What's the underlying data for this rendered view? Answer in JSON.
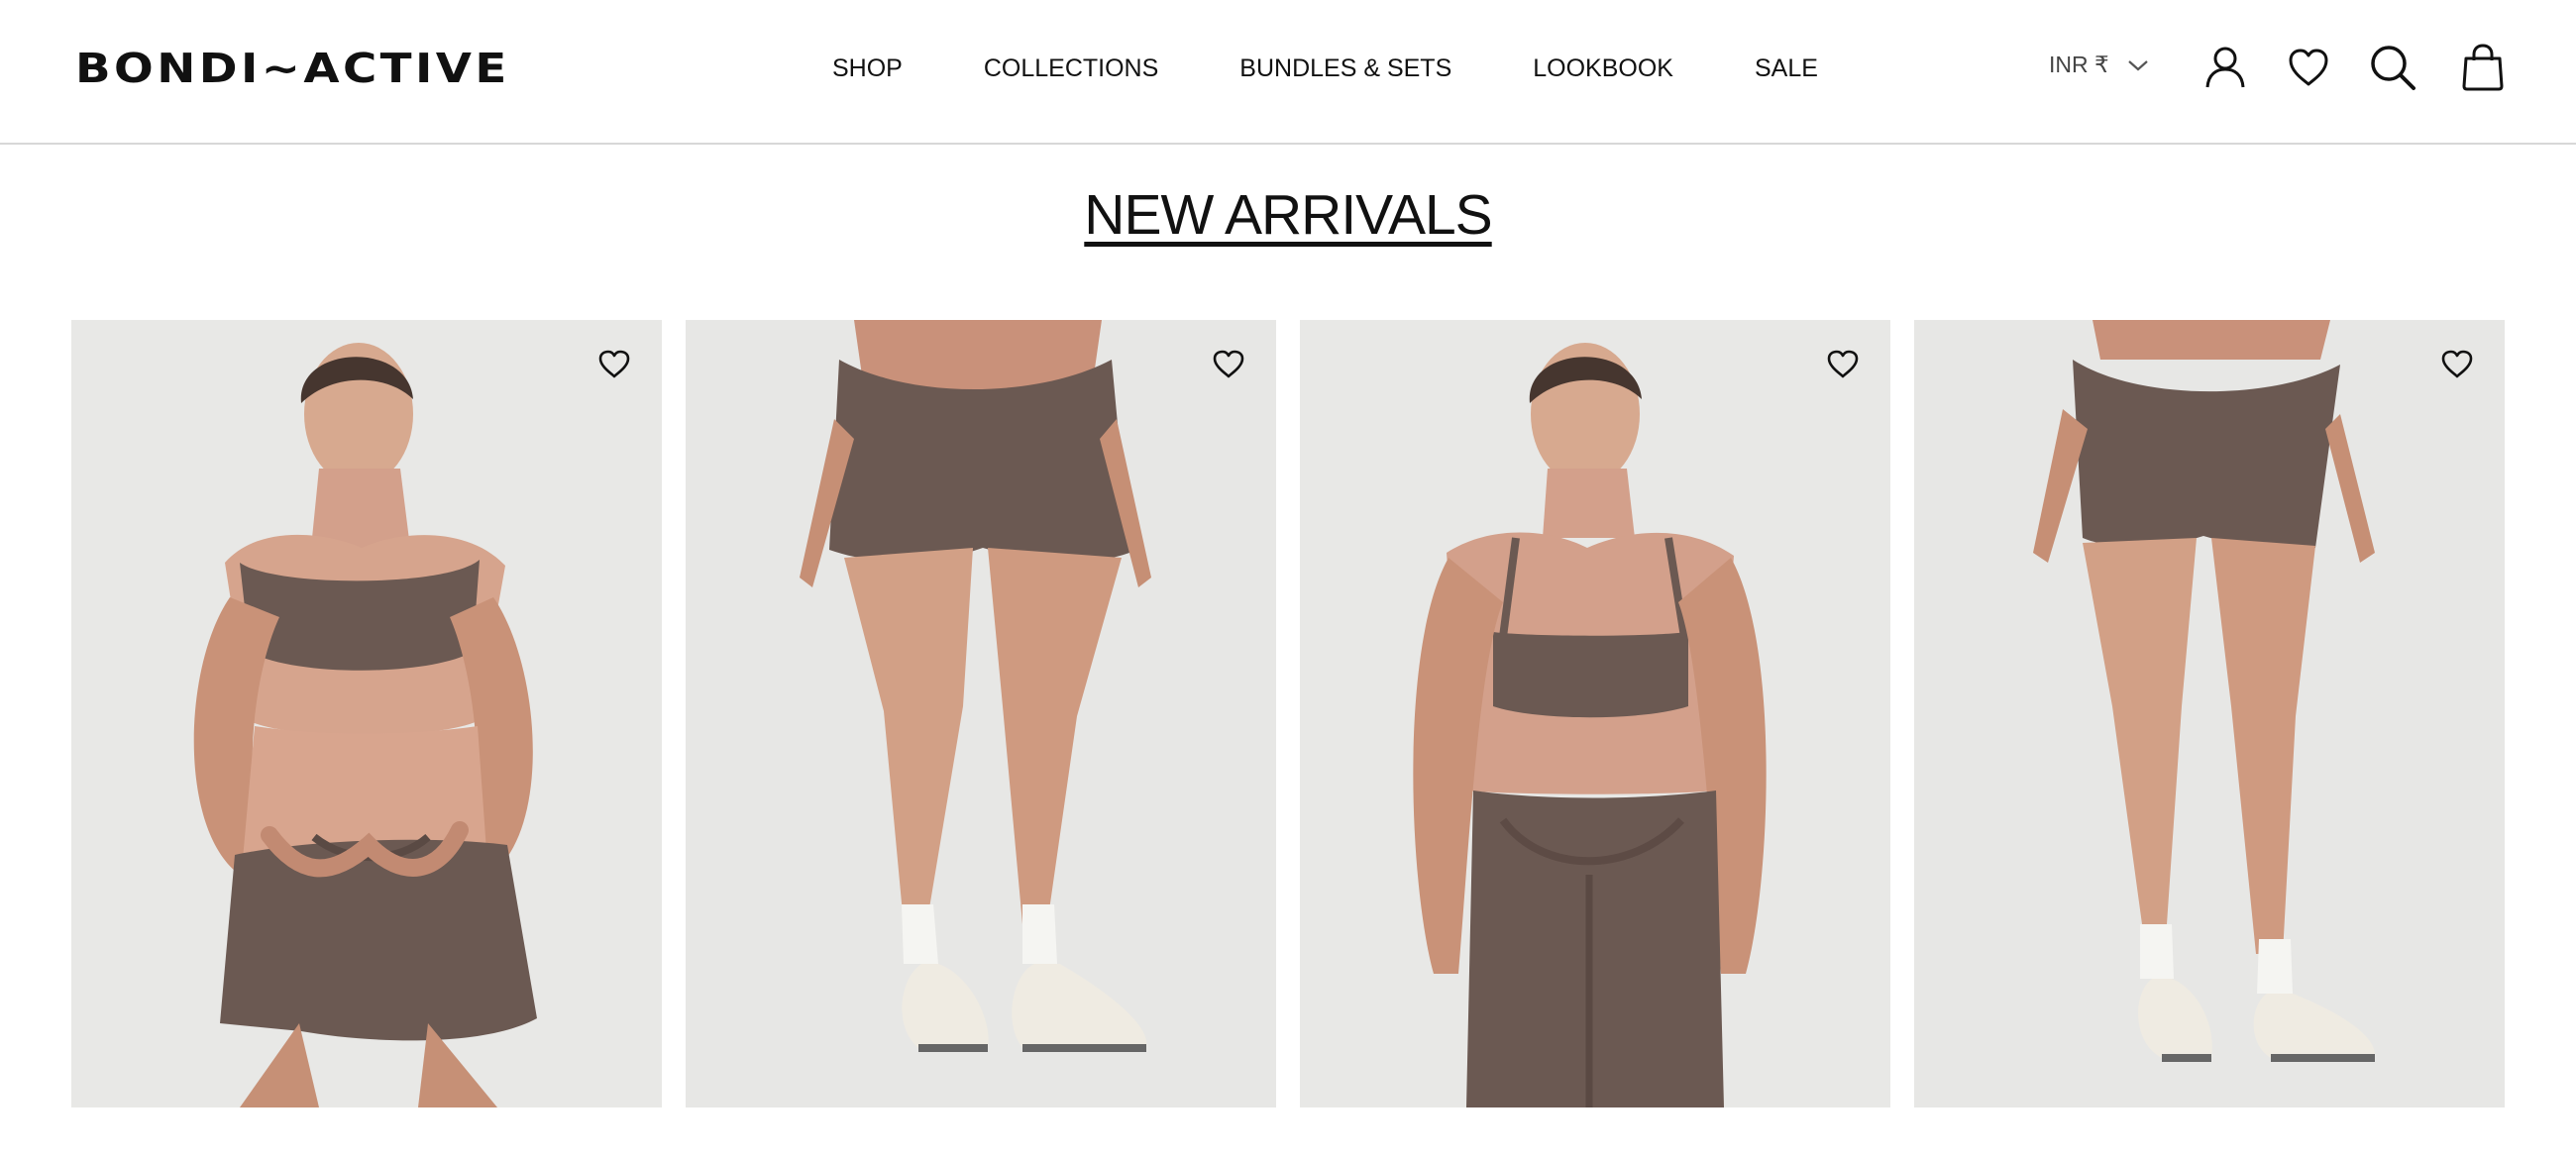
{
  "brand": {
    "logo_text": "BONDI~ACTIVE"
  },
  "nav": {
    "items": [
      {
        "label": "SHOP"
      },
      {
        "label": "COLLECTIONS"
      },
      {
        "label": "BUNDLES & SETS"
      },
      {
        "label": "LOOKBOOK"
      },
      {
        "label": "SALE"
      }
    ]
  },
  "utility": {
    "currency": "INR ₹",
    "icons": [
      "account-icon",
      "wishlist-icon",
      "search-icon",
      "cart-icon"
    ]
  },
  "section": {
    "title": "NEW ARRIVALS"
  },
  "products": [
    {
      "image": "model in brown sports bra and shorts",
      "wishlist_icon": "heart-icon"
    },
    {
      "image": "brown bike shorts with sneakers",
      "wishlist_icon": "heart-icon"
    },
    {
      "image": "model in brown strappy bra and leggings",
      "wishlist_icon": "heart-icon"
    },
    {
      "image": "brown shorts with sneakers",
      "wishlist_icon": "heart-icon"
    }
  ],
  "colors": {
    "brand_text": "#111111",
    "product_background": "#e8e8e6",
    "product_brown": "#6b5952"
  }
}
